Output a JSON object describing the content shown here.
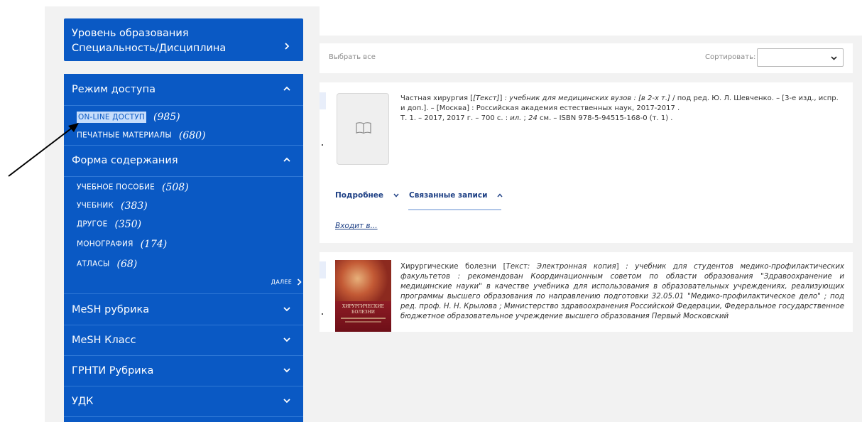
{
  "sidebar": {
    "level_box": {
      "line1": "Уровень образования",
      "line2": "Специальность/Дисциплина"
    },
    "sections": [
      {
        "title": "Режим доступа"
      },
      {
        "title": "Форма содержания"
      },
      {
        "title": "MeSH рубрика"
      },
      {
        "title": "MeSH Класс"
      },
      {
        "title": "ГРНТИ Рубрика"
      },
      {
        "title": "УДК"
      }
    ],
    "access_items": [
      {
        "label": "ON-LINE ДОСТУП",
        "count": "(985)"
      },
      {
        "label": "ПЕЧАТНЫЕ МАТЕРИАЛЫ",
        "count": "(680)"
      }
    ],
    "form_items": [
      {
        "label": "УЧЕБНОЕ ПОСОБИЕ",
        "count": "(508)"
      },
      {
        "label": "УЧЕБНИК",
        "count": "(383)"
      },
      {
        "label": "ДРУГОЕ",
        "count": "(350)"
      },
      {
        "label": "МОНОГРАФИЯ",
        "count": "(174)"
      },
      {
        "label": "АТЛАСЫ",
        "count": "(68)"
      }
    ],
    "more": "ДАЛЕЕ"
  },
  "toolbar": {
    "select_all": "Выбрать все",
    "sort_label": "Сортировать:",
    "sort_value": ""
  },
  "records": [
    {
      "title": "Частная хирургия",
      "type": "[Текст]",
      "subtitle": ": учебник для медицинских вузов : [в 2-х т.]",
      "resp": "/ под ред. Ю. Л. Шевченко. – [3-е изд., испр. и доп.]. – [Москва] : Российская академия естественных наук, 2017-2017 .",
      "vol_line_a": "Т. 1. – 2017, 2017 г. – 700 с. :",
      "vol_ill": "ил.",
      "vol_sep": ";",
      "vol_size": "24",
      "vol_line_b": "см. – ISBN 978-5-94515-168-0 (т. 1) .",
      "more_link": "Подробнее",
      "related_link": "Связанные записи",
      "included_link": "Входит в..."
    },
    {
      "title": "Хирургические болезни",
      "type_it": "Текст: Электронная копия",
      "text_it": ": учебник для студентов медико-профилактических факультетов : рекомендован Координационным советом по области образования \"Здравоохранение и медицинские науки\" в качестве учебника для использования в образовательных учреждениях, реализующих программы высшего образования по направлению подготовки 32.05.01 \"Медико-профилактическое дело\"",
      "resp_it": "; под ред. проф. Н. Н. Крылова ; Министерство здравоохранения Российской Федерации, Федеральное государственное бюджетное образовательное учреждение высшего образования Первый Московский",
      "cover_title": "ХИРУРГИЧЕСКИЕ БОЛЕЗНИ"
    }
  ],
  "colors": {
    "sidebar_blue": "#0a59c4",
    "link_blue": "#1d3f84",
    "selected_bg": "#c7ddfb"
  },
  "icons": [
    "chevron-right-icon",
    "chevron-up-icon",
    "chevron-down-icon",
    "book-icon",
    "arrow-annotation"
  ]
}
